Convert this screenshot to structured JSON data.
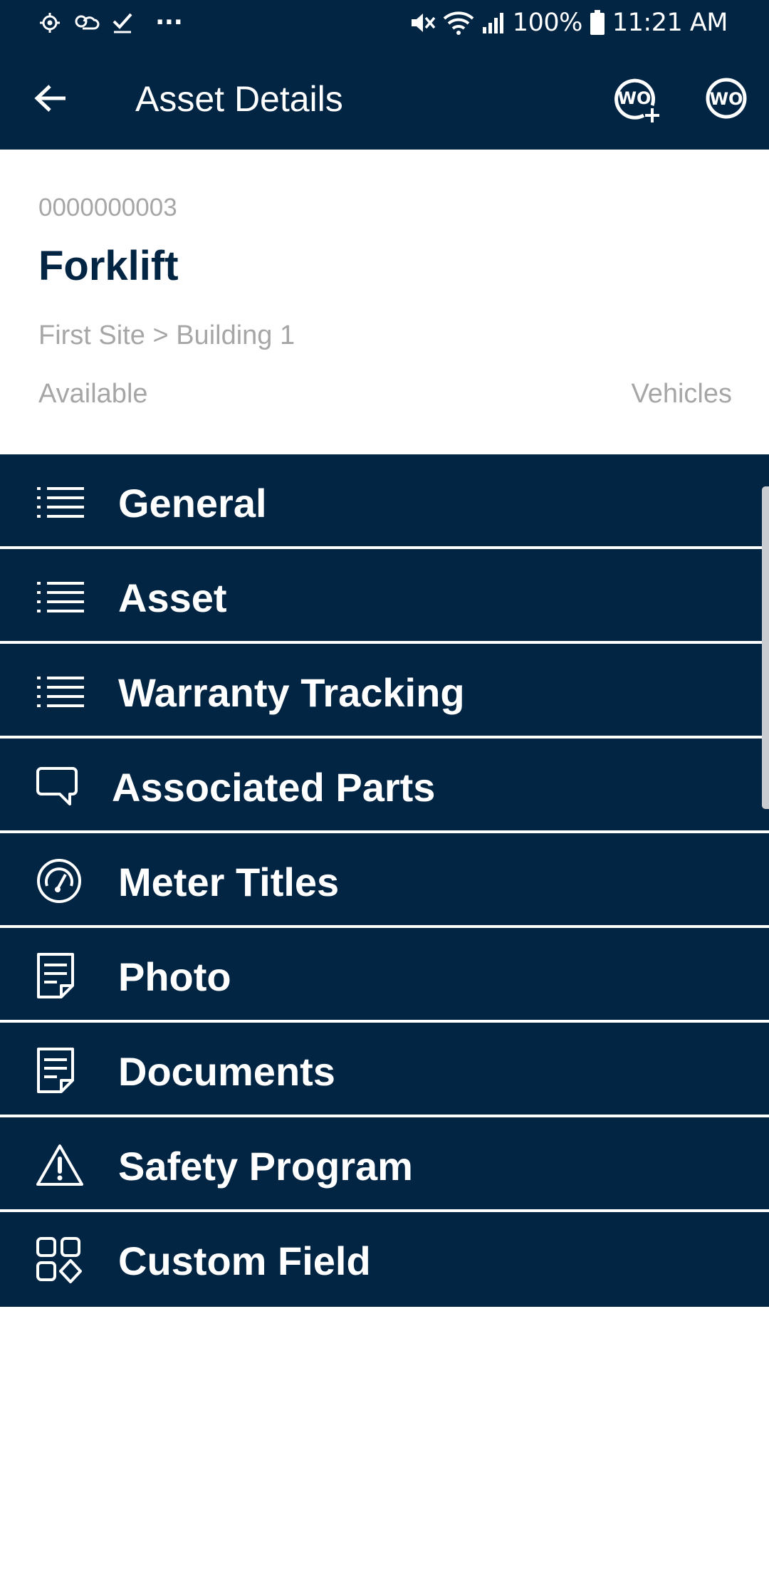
{
  "status_bar": {
    "battery": "100%",
    "time": "11:21 AM",
    "overflow": "···"
  },
  "app_bar": {
    "title": "Asset Details",
    "actions": [
      "add-work-order",
      "work-order"
    ]
  },
  "asset": {
    "id": "0000000003",
    "name": "Forklift",
    "location": "First Site > Building 1",
    "status": "Available",
    "category": "Vehicles"
  },
  "menu": {
    "items": [
      {
        "label": "General",
        "icon": "list-icon"
      },
      {
        "label": "Asset",
        "icon": "list-icon"
      },
      {
        "label": "Warranty Tracking",
        "icon": "list-icon"
      },
      {
        "label": "Associated Parts",
        "icon": "chat-bubble-icon"
      },
      {
        "label": "Meter Titles",
        "icon": "gauge-icon"
      },
      {
        "label": "Photo",
        "icon": "document-icon"
      },
      {
        "label": "Documents",
        "icon": "document-icon"
      },
      {
        "label": "Safety Program",
        "icon": "warning-icon"
      },
      {
        "label": "Custom Field",
        "icon": "grid-shapes-icon"
      }
    ]
  },
  "colors": {
    "primary": "#022544",
    "muted_text": "#a6a6a6",
    "background": "#ffffff"
  }
}
